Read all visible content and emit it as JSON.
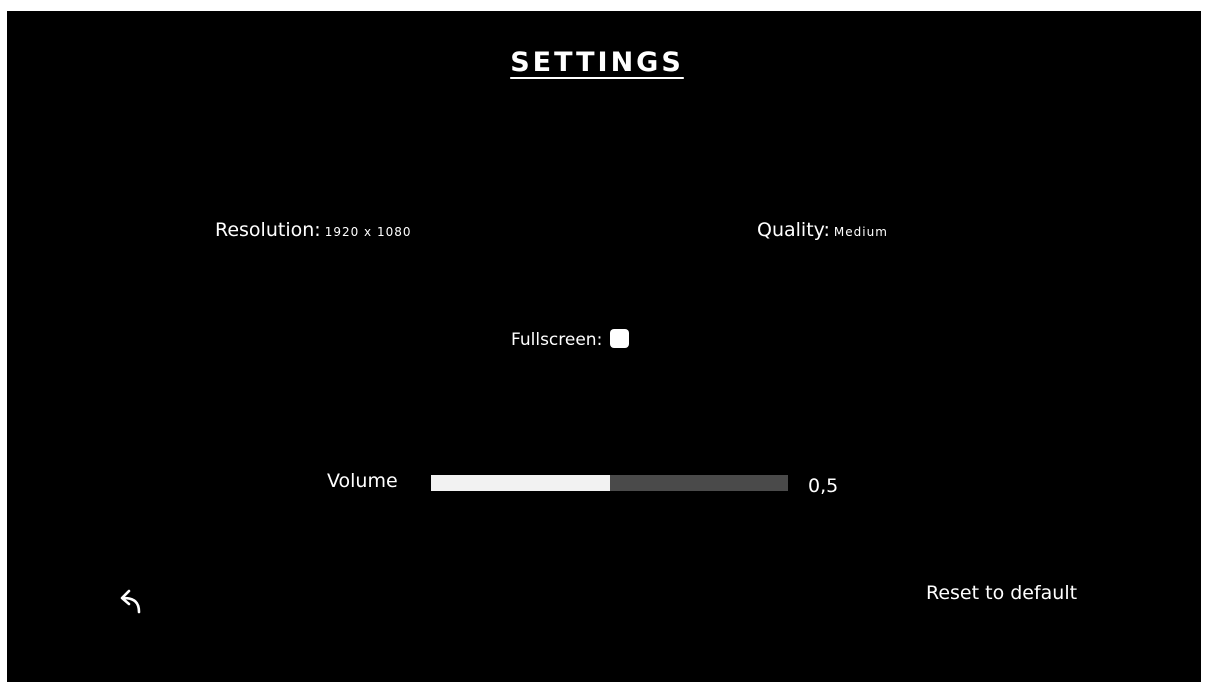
{
  "title": "SETTINGS",
  "resolution": {
    "label": "Resolution:",
    "value": "1920 x 1080"
  },
  "quality": {
    "label": "Quality:",
    "value": "Medium"
  },
  "fullscreen": {
    "label": "Fullscreen:",
    "checked": false
  },
  "volume": {
    "label": "Volume",
    "value_text": "0,5",
    "level": 0.5
  },
  "back_icon": "back-arrow-icon",
  "reset_label": "Reset to default",
  "colors": {
    "background": "#000000",
    "text": "#ffffff",
    "slider_fill": "#f2f2f2",
    "slider_track": "#4a4a4a"
  }
}
